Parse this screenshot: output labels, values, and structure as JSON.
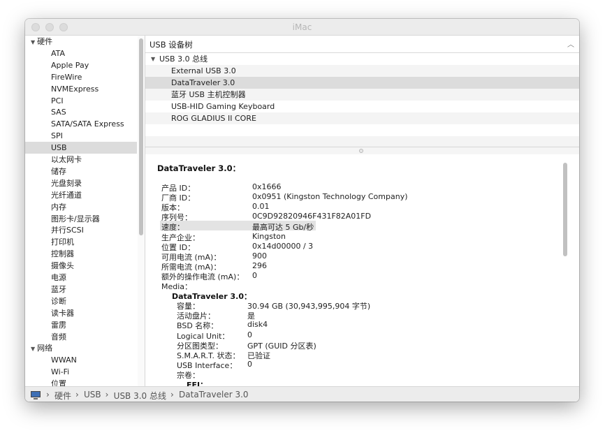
{
  "window": {
    "title": "iMac"
  },
  "sidebar": {
    "items": [
      {
        "label": "硬件",
        "kind": "group",
        "expanded": true
      },
      {
        "label": "ATA",
        "kind": "item"
      },
      {
        "label": "Apple Pay",
        "kind": "item"
      },
      {
        "label": "FireWire",
        "kind": "item"
      },
      {
        "label": "NVMExpress",
        "kind": "item"
      },
      {
        "label": "PCI",
        "kind": "item"
      },
      {
        "label": "SAS",
        "kind": "item"
      },
      {
        "label": "SATA/SATA Express",
        "kind": "item"
      },
      {
        "label": "SPI",
        "kind": "item"
      },
      {
        "label": "USB",
        "kind": "item",
        "selected": true
      },
      {
        "label": "以太网卡",
        "kind": "item"
      },
      {
        "label": "储存",
        "kind": "item"
      },
      {
        "label": "光盘刻录",
        "kind": "item"
      },
      {
        "label": "光纤通道",
        "kind": "item"
      },
      {
        "label": "内存",
        "kind": "item"
      },
      {
        "label": "图形卡/显示器",
        "kind": "item"
      },
      {
        "label": "并行SCSI",
        "kind": "item"
      },
      {
        "label": "打印机",
        "kind": "item"
      },
      {
        "label": "控制器",
        "kind": "item"
      },
      {
        "label": "摄像头",
        "kind": "item"
      },
      {
        "label": "电源",
        "kind": "item"
      },
      {
        "label": "蓝牙",
        "kind": "item"
      },
      {
        "label": "诊断",
        "kind": "item"
      },
      {
        "label": "读卡器",
        "kind": "item"
      },
      {
        "label": "雷雳",
        "kind": "item"
      },
      {
        "label": "音频",
        "kind": "item"
      },
      {
        "label": "网络",
        "kind": "group",
        "expanded": true
      },
      {
        "label": "WWAN",
        "kind": "item"
      },
      {
        "label": "Wi-Fi",
        "kind": "item"
      },
      {
        "label": "位置",
        "kind": "item"
      }
    ]
  },
  "tree": {
    "header": "USB 设备树",
    "root": "USB 3.0 总线",
    "devices": [
      {
        "label": "External USB 3.0"
      },
      {
        "label": "DataTraveler 3.0",
        "selected": true
      },
      {
        "label": "蓝牙 USB 主机控制器"
      },
      {
        "label": "USB-HID Gaming Keyboard"
      },
      {
        "label": "ROG GLADIUS II CORE"
      }
    ]
  },
  "detail": {
    "title": "DataTraveler 3.0：",
    "properties": [
      {
        "label": "产品 ID：",
        "value": "0x1666"
      },
      {
        "label": "厂商 ID：",
        "value": "0x0951  (Kingston Technology Company)"
      },
      {
        "label": "版本：",
        "value": "0.01"
      },
      {
        "label": "序列号：",
        "value": "0C9D92820946F431F82A01FD"
      },
      {
        "label": "速度：",
        "value": "最高可达 5 Gb/秒",
        "highlighted": true
      },
      {
        "label": "生产企业：",
        "value": "Kingston"
      },
      {
        "label": "位置 ID：",
        "value": "0x14d00000 / 3"
      },
      {
        "label": "可用电流 (mA)：",
        "value": "900"
      },
      {
        "label": "所需电流 (mA)：",
        "value": "296"
      },
      {
        "label": "额外的操作电流 (mA)：",
        "value": "0"
      }
    ],
    "media_label": "Media：",
    "media_title": "DataTraveler 3.0：",
    "media_properties": [
      {
        "label": "容量：",
        "value": "30.94 GB (30,943,995,904 字节)"
      },
      {
        "label": "活动盘片：",
        "value": "是"
      },
      {
        "label": "BSD 名称：",
        "value": "disk4"
      },
      {
        "label": "Logical Unit：",
        "value": "0"
      },
      {
        "label": "分区图类型：",
        "value": "GPT (GUID 分区表)"
      },
      {
        "label": "S.M.A.R.T. 状态：",
        "value": "已验证"
      },
      {
        "label": "USB Interface：",
        "value": "0"
      }
    ],
    "volumes_label": "宗卷：",
    "volume_name": "EFI："
  },
  "statusbar": {
    "icon": "imac-icon",
    "crumbs": [
      "硬件",
      "USB",
      "USB 3.0 总线",
      "DataTraveler 3.0"
    ],
    "separator": "›"
  }
}
